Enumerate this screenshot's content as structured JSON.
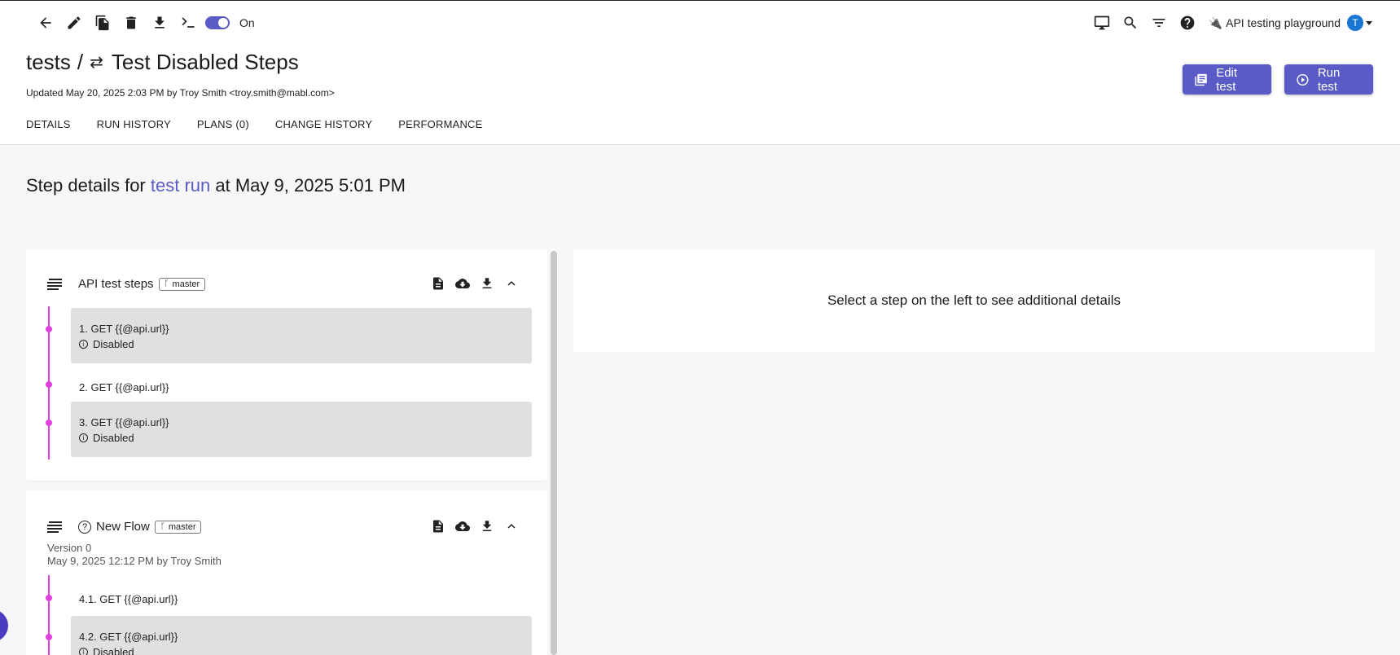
{
  "toolbar": {
    "toggle_label": "On"
  },
  "header": {
    "workspace": "API testing playground",
    "avatar_initial": "T",
    "breadcrumb_root": "tests",
    "breadcrumb_sep": "/",
    "test_name": "Test Disabled Steps",
    "updated": "Updated May 20, 2025 2:03 PM by Troy Smith <troy.smith@mabl.com>",
    "edit_label": "Edit test",
    "run_label": "Run test"
  },
  "tabs": [
    {
      "label": "DETAILS"
    },
    {
      "label": "RUN HISTORY"
    },
    {
      "label": "PLANS (0)"
    },
    {
      "label": "CHANGE HISTORY"
    },
    {
      "label": "PERFORMANCE"
    }
  ],
  "main": {
    "heading_prefix": "Step details for",
    "heading_link": "test run",
    "heading_suffix": "at May 9, 2025 5:01 PM",
    "right_message": "Select a step on the left to see additional details"
  },
  "cards": [
    {
      "title": "API test steps",
      "branch": "master",
      "steps": [
        {
          "label": "1. GET {{@api.url}}",
          "status": "Disabled"
        },
        {
          "label": "2. GET {{@api.url}}"
        },
        {
          "label": "3. GET {{@api.url}}",
          "status": "Disabled"
        }
      ]
    },
    {
      "title": "New Flow",
      "branch": "master",
      "version": "Version 0",
      "meta": "May 9, 2025 12:12 PM by Troy Smith",
      "steps": [
        {
          "label": "4.1. GET {{@api.url}}"
        },
        {
          "label": "4.2. GET {{@api.url}}",
          "status": "Disabled"
        }
      ]
    }
  ]
}
